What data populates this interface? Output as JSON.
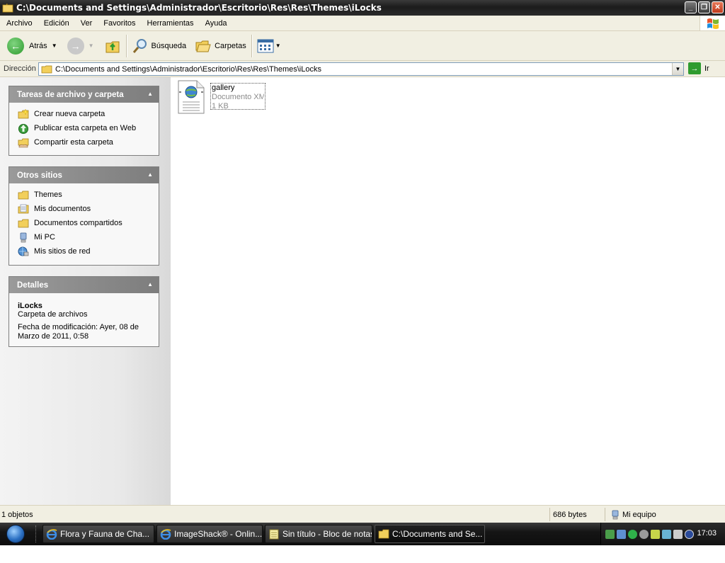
{
  "window": {
    "title": "C:\\Documents and Settings\\Administrador\\Escritorio\\Res\\Res\\Themes\\iLocks",
    "buttons": [
      "minimize",
      "restore",
      "close"
    ]
  },
  "menubar": {
    "items": [
      "Archivo",
      "Edición",
      "Ver",
      "Favoritos",
      "Herramientas",
      "Ayuda"
    ]
  },
  "toolbar": {
    "back_label": "Atrás",
    "search_label": "Búsqueda",
    "folders_label": "Carpetas"
  },
  "address": {
    "label": "Dirección",
    "value": "C:\\Documents and Settings\\Administrador\\Escritorio\\Res\\Res\\Themes\\iLocks",
    "go_label": "Ir"
  },
  "tasks_panel": {
    "title": "Tareas de archivo y carpeta",
    "items": [
      {
        "label": "Crear nueva carpeta",
        "icon": "new-folder-icon"
      },
      {
        "label": "Publicar esta carpeta en Web",
        "icon": "publish-web-icon"
      },
      {
        "label": "Compartir esta carpeta",
        "icon": "share-folder-icon"
      }
    ]
  },
  "places_panel": {
    "title": "Otros sitios",
    "items": [
      {
        "label": "Themes",
        "icon": "folder-icon"
      },
      {
        "label": "Mis documentos",
        "icon": "my-documents-icon"
      },
      {
        "label": "Documentos compartidos",
        "icon": "folder-icon"
      },
      {
        "label": "Mi PC",
        "icon": "my-computer-icon"
      },
      {
        "label": "Mis sitios de red",
        "icon": "network-places-icon"
      }
    ]
  },
  "details_panel": {
    "title": "Detalles",
    "name": "iLocks",
    "type": "Carpeta de archivos",
    "modified_line1": "Fecha de modificación: Ayer, 08 de",
    "modified_line2": "Marzo de 2011, 0:58"
  },
  "files": [
    {
      "name": "gallery",
      "type": "Documento XML",
      "size": "1 KB",
      "icon": "xml-document-icon"
    }
  ],
  "statusbar": {
    "count": "1 objetos",
    "size": "686 bytes",
    "location": "Mi equipo"
  },
  "taskbar": {
    "tasks": [
      {
        "label": "Flora y Fauna de Cha...",
        "icon": "ie-icon",
        "active": false
      },
      {
        "label": "ImageShack® - Onlin...",
        "icon": "ie-icon",
        "active": false
      },
      {
        "label": "Sin título - Bloc de notas",
        "icon": "notepad-icon",
        "active": false
      },
      {
        "label": "C:\\Documents and Se...",
        "icon": "folder-icon",
        "active": true
      }
    ],
    "clock": "17:03"
  }
}
